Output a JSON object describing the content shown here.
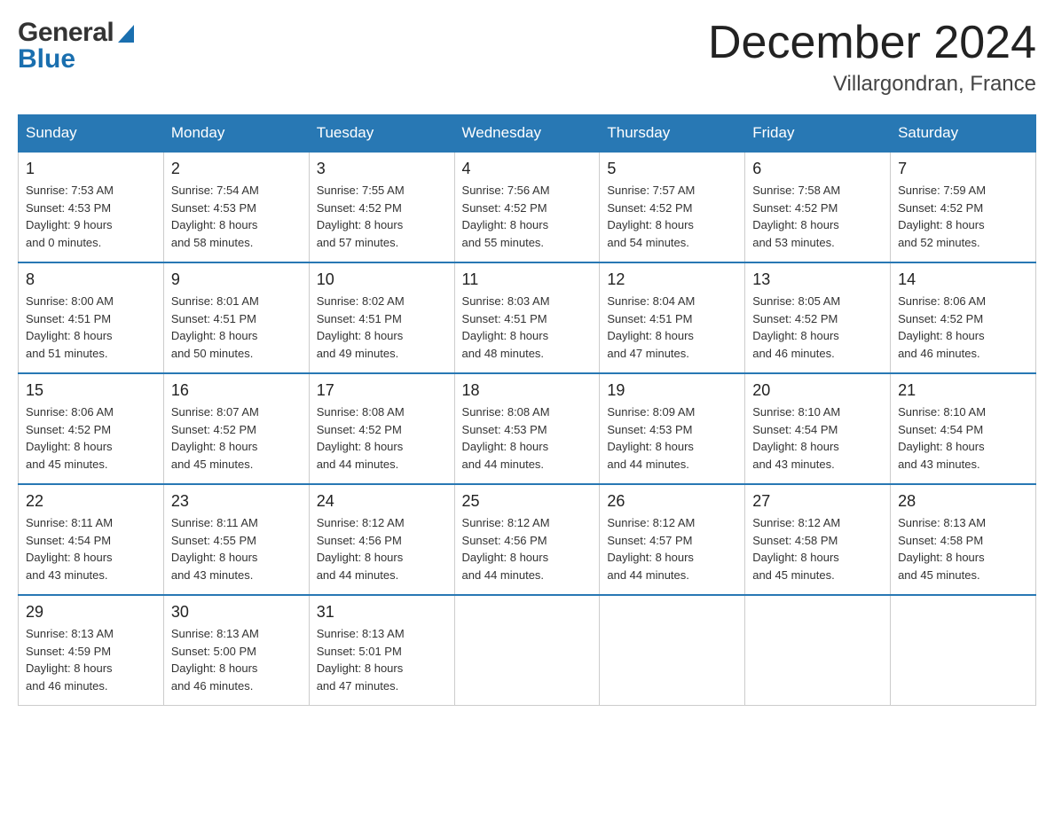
{
  "header": {
    "logo_general": "General",
    "logo_blue": "Blue",
    "title": "December 2024",
    "subtitle": "Villargondran, France"
  },
  "days_of_week": [
    "Sunday",
    "Monday",
    "Tuesday",
    "Wednesday",
    "Thursday",
    "Friday",
    "Saturday"
  ],
  "weeks": [
    [
      {
        "day": "1",
        "info": "Sunrise: 7:53 AM\nSunset: 4:53 PM\nDaylight: 9 hours\nand 0 minutes."
      },
      {
        "day": "2",
        "info": "Sunrise: 7:54 AM\nSunset: 4:53 PM\nDaylight: 8 hours\nand 58 minutes."
      },
      {
        "day": "3",
        "info": "Sunrise: 7:55 AM\nSunset: 4:52 PM\nDaylight: 8 hours\nand 57 minutes."
      },
      {
        "day": "4",
        "info": "Sunrise: 7:56 AM\nSunset: 4:52 PM\nDaylight: 8 hours\nand 55 minutes."
      },
      {
        "day": "5",
        "info": "Sunrise: 7:57 AM\nSunset: 4:52 PM\nDaylight: 8 hours\nand 54 minutes."
      },
      {
        "day": "6",
        "info": "Sunrise: 7:58 AM\nSunset: 4:52 PM\nDaylight: 8 hours\nand 53 minutes."
      },
      {
        "day": "7",
        "info": "Sunrise: 7:59 AM\nSunset: 4:52 PM\nDaylight: 8 hours\nand 52 minutes."
      }
    ],
    [
      {
        "day": "8",
        "info": "Sunrise: 8:00 AM\nSunset: 4:51 PM\nDaylight: 8 hours\nand 51 minutes."
      },
      {
        "day": "9",
        "info": "Sunrise: 8:01 AM\nSunset: 4:51 PM\nDaylight: 8 hours\nand 50 minutes."
      },
      {
        "day": "10",
        "info": "Sunrise: 8:02 AM\nSunset: 4:51 PM\nDaylight: 8 hours\nand 49 minutes."
      },
      {
        "day": "11",
        "info": "Sunrise: 8:03 AM\nSunset: 4:51 PM\nDaylight: 8 hours\nand 48 minutes."
      },
      {
        "day": "12",
        "info": "Sunrise: 8:04 AM\nSunset: 4:51 PM\nDaylight: 8 hours\nand 47 minutes."
      },
      {
        "day": "13",
        "info": "Sunrise: 8:05 AM\nSunset: 4:52 PM\nDaylight: 8 hours\nand 46 minutes."
      },
      {
        "day": "14",
        "info": "Sunrise: 8:06 AM\nSunset: 4:52 PM\nDaylight: 8 hours\nand 46 minutes."
      }
    ],
    [
      {
        "day": "15",
        "info": "Sunrise: 8:06 AM\nSunset: 4:52 PM\nDaylight: 8 hours\nand 45 minutes."
      },
      {
        "day": "16",
        "info": "Sunrise: 8:07 AM\nSunset: 4:52 PM\nDaylight: 8 hours\nand 45 minutes."
      },
      {
        "day": "17",
        "info": "Sunrise: 8:08 AM\nSunset: 4:52 PM\nDaylight: 8 hours\nand 44 minutes."
      },
      {
        "day": "18",
        "info": "Sunrise: 8:08 AM\nSunset: 4:53 PM\nDaylight: 8 hours\nand 44 minutes."
      },
      {
        "day": "19",
        "info": "Sunrise: 8:09 AM\nSunset: 4:53 PM\nDaylight: 8 hours\nand 44 minutes."
      },
      {
        "day": "20",
        "info": "Sunrise: 8:10 AM\nSunset: 4:54 PM\nDaylight: 8 hours\nand 43 minutes."
      },
      {
        "day": "21",
        "info": "Sunrise: 8:10 AM\nSunset: 4:54 PM\nDaylight: 8 hours\nand 43 minutes."
      }
    ],
    [
      {
        "day": "22",
        "info": "Sunrise: 8:11 AM\nSunset: 4:54 PM\nDaylight: 8 hours\nand 43 minutes."
      },
      {
        "day": "23",
        "info": "Sunrise: 8:11 AM\nSunset: 4:55 PM\nDaylight: 8 hours\nand 43 minutes."
      },
      {
        "day": "24",
        "info": "Sunrise: 8:12 AM\nSunset: 4:56 PM\nDaylight: 8 hours\nand 44 minutes."
      },
      {
        "day": "25",
        "info": "Sunrise: 8:12 AM\nSunset: 4:56 PM\nDaylight: 8 hours\nand 44 minutes."
      },
      {
        "day": "26",
        "info": "Sunrise: 8:12 AM\nSunset: 4:57 PM\nDaylight: 8 hours\nand 44 minutes."
      },
      {
        "day": "27",
        "info": "Sunrise: 8:12 AM\nSunset: 4:58 PM\nDaylight: 8 hours\nand 45 minutes."
      },
      {
        "day": "28",
        "info": "Sunrise: 8:13 AM\nSunset: 4:58 PM\nDaylight: 8 hours\nand 45 minutes."
      }
    ],
    [
      {
        "day": "29",
        "info": "Sunrise: 8:13 AM\nSunset: 4:59 PM\nDaylight: 8 hours\nand 46 minutes."
      },
      {
        "day": "30",
        "info": "Sunrise: 8:13 AM\nSunset: 5:00 PM\nDaylight: 8 hours\nand 46 minutes."
      },
      {
        "day": "31",
        "info": "Sunrise: 8:13 AM\nSunset: 5:01 PM\nDaylight: 8 hours\nand 47 minutes."
      },
      {
        "day": "",
        "info": ""
      },
      {
        "day": "",
        "info": ""
      },
      {
        "day": "",
        "info": ""
      },
      {
        "day": "",
        "info": ""
      }
    ]
  ]
}
